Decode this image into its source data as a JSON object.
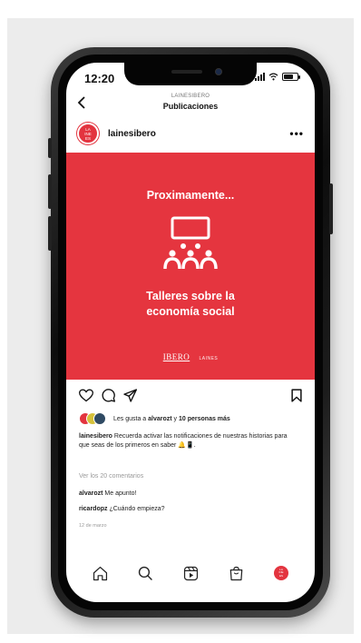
{
  "status_bar": {
    "time": "12:20"
  },
  "header": {
    "account": "LAINESIBERO",
    "title": "Publicaciones"
  },
  "profile": {
    "avatar_text": "LA\nINE\nES",
    "username": "lainesibero",
    "more_icon": "more-dots-icon"
  },
  "post": {
    "heading": "Proximamente...",
    "body_line1": "Talleres sobre la",
    "body_line2": "economía social",
    "logo_ibero": "IBERO",
    "logo_laines": "LAINES",
    "background_color": "#e5353f",
    "icon": "workshop-presentation-icon"
  },
  "actions": {
    "like_icon": "heart-icon",
    "comment_icon": "comment-icon",
    "share_icon": "send-icon",
    "save_icon": "bookmark-icon"
  },
  "likes": {
    "prefix": "Les gusta a ",
    "user": "alvarozt",
    "connector": " y ",
    "others": "10 personas más",
    "avatar_colors": [
      "#e3343f",
      "#d5c13a",
      "#2f4a63"
    ]
  },
  "caption": {
    "username": "lainesibero",
    "text": " Recuerda activar las notificaciones de nuestras historias para que seas de los primeros en saber 🔔📱."
  },
  "view_comments": "Ver los 20 comentarios",
  "comments": [
    {
      "user": "alvarozt",
      "text": " Me apunto!"
    },
    {
      "user": "ricardopz",
      "text": " ¿Cuándo empieza?"
    }
  ],
  "date": "12 de marzo",
  "tabbar": {
    "items": [
      "home-icon",
      "search-icon",
      "reels-icon",
      "shop-icon",
      "profile-avatar"
    ],
    "avatar_text": "LA\nINE\nES"
  }
}
